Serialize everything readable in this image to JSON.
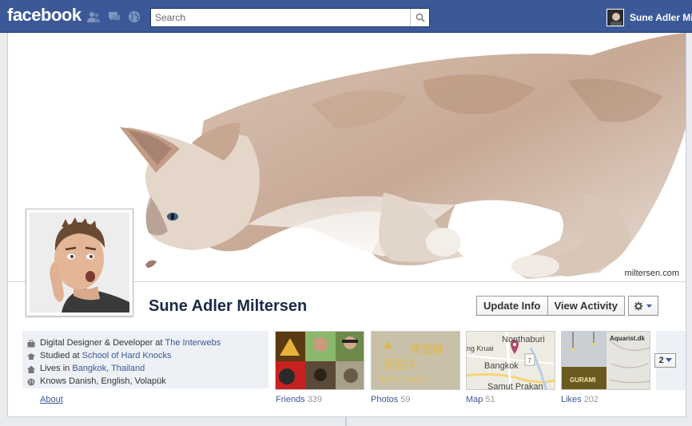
{
  "topbar": {
    "logo": "facebook",
    "search_placeholder": "Search",
    "user_name": "Sune Adler Mi"
  },
  "profile": {
    "name": "Sune Adler Miltersen",
    "cover_credit": "miltersen.com"
  },
  "actions": {
    "update_info": "Update Info",
    "view_activity": "View Activity"
  },
  "info": {
    "work_prefix": "Digital Designer & Developer at ",
    "work_link": "The Interwebs",
    "study_prefix": "Studied at ",
    "study_link": "School of Hard Knocks",
    "live_prefix": "Lives in ",
    "live_link": "Bangkok, Thailand",
    "languages": "Knows Danish, English, Volapük",
    "about": "About"
  },
  "apps": [
    {
      "label": "Friends",
      "count": "339"
    },
    {
      "label": "Photos",
      "count": "59"
    },
    {
      "label": "Map",
      "count": "51"
    },
    {
      "label": "Likes",
      "count": "202"
    }
  ],
  "map_labels": {
    "place1": "Nonthaburi",
    "place2": "Krung Kruai",
    "place3": "Bangkok",
    "place4": "Samut Prakan"
  },
  "photo_caption": "天怨人",
  "likes_captions": {
    "left": "GURAMI",
    "right": "Aquarist.dk"
  },
  "more": {
    "label": "2"
  },
  "colors": {
    "brand_blue": "#3b5998",
    "link_blue": "#3b5998",
    "name_color": "#1c2a47"
  }
}
